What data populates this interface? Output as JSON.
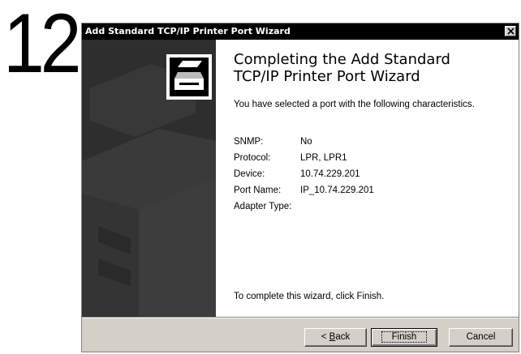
{
  "step_number": "12",
  "window": {
    "title": "Add Standard TCP/IP Printer Port Wizard",
    "close_label": "×"
  },
  "heading": {
    "line1": "Completing the Add Standard",
    "line2": "TCP/IP Printer Port Wizard"
  },
  "intro": "You have selected a port with the following characteristics.",
  "properties": [
    {
      "label": "SNMP:",
      "value": "No"
    },
    {
      "label": "Protocol:",
      "value": "LPR, LPR1"
    },
    {
      "label": "Device:",
      "value": "10.74.229.201"
    },
    {
      "label": "Port Name:",
      "value": "IP_10.74.229.201"
    },
    {
      "label": "Adapter Type:",
      "value": ""
    }
  ],
  "footer_text": "To complete this wizard, click Finish.",
  "buttons": {
    "back_prefix": "< ",
    "back_mnemonic": "B",
    "back_rest": "ack",
    "finish": "Finish",
    "cancel": "Cancel"
  },
  "colors": {
    "titlebar": "#000000",
    "banner": "#2e2e2e",
    "dialog_face": "#d4d0c8"
  },
  "icons": {
    "wizard_logo": "printer-wizard-icon",
    "banner_art": "printer-watermark"
  }
}
